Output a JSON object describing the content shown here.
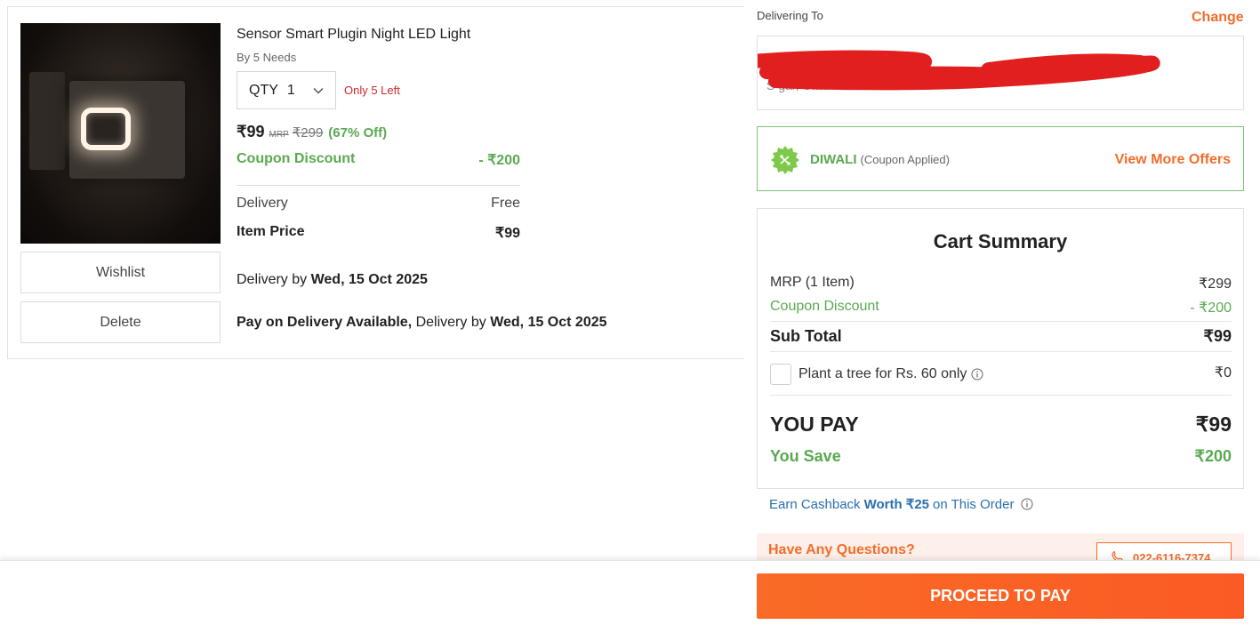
{
  "product": {
    "title": "Sensor Smart Plugin Night LED Light",
    "brand": "By 5 Needs",
    "qty_label": "QTY",
    "qty_value": "1",
    "stock_note": "Only 5 Left",
    "price": "₹99",
    "mrp_label": "MRP",
    "mrp_value": "₹299",
    "discount": "(67% Off)",
    "coupon_label": "Coupon Discount",
    "coupon_value": "- ₹200",
    "delivery_label": "Delivery",
    "delivery_value": "Free",
    "item_price_label": "Item Price",
    "item_price_value": "₹99",
    "delivery_by_label": "Delivery by",
    "delivery_by_date": "Wed, 15 Oct 2025",
    "pod_label": "Pay on Delivery Available,",
    "pod_delivery_label": "Delivery by",
    "pod_date": "Wed, 15 Oct 2025",
    "wishlist_label": "Wishlist",
    "delete_label": "Delete"
  },
  "address": {
    "heading": "Delivering To",
    "change_label": "Change",
    "visible_fragment": "S                                     gar, Uttar Pradesh"
  },
  "coupon": {
    "code": "DIWALI",
    "status": "(Coupon Applied)",
    "view_more_label": "View More Offers"
  },
  "summary": {
    "title": "Cart Summary",
    "mrp_label": "MRP (1 Item)",
    "mrp_value": "₹299",
    "coupon_label": "Coupon Discount",
    "coupon_value": "- ₹200",
    "subtotal_label": "Sub Total",
    "subtotal_value": "₹99",
    "plant_label": "Plant a tree for Rs. 60 only",
    "plant_value": "₹0",
    "you_pay_label": "YOU PAY",
    "you_pay_value": "₹99",
    "you_save_label": "You Save",
    "you_save_value": "₹200"
  },
  "cashback": {
    "prefix": "Earn Cashback",
    "amount": "Worth ₹25",
    "suffix": "on This Order"
  },
  "help": {
    "question": "Have Any Questions?",
    "phone": "022-6116-7374"
  },
  "cta": {
    "proceed_label": "PROCEED TO PAY"
  },
  "colors": {
    "accent": "#f36d2b",
    "green": "#5aa951",
    "stock_red": "#d3262e",
    "link_blue": "#2a6fb0"
  }
}
